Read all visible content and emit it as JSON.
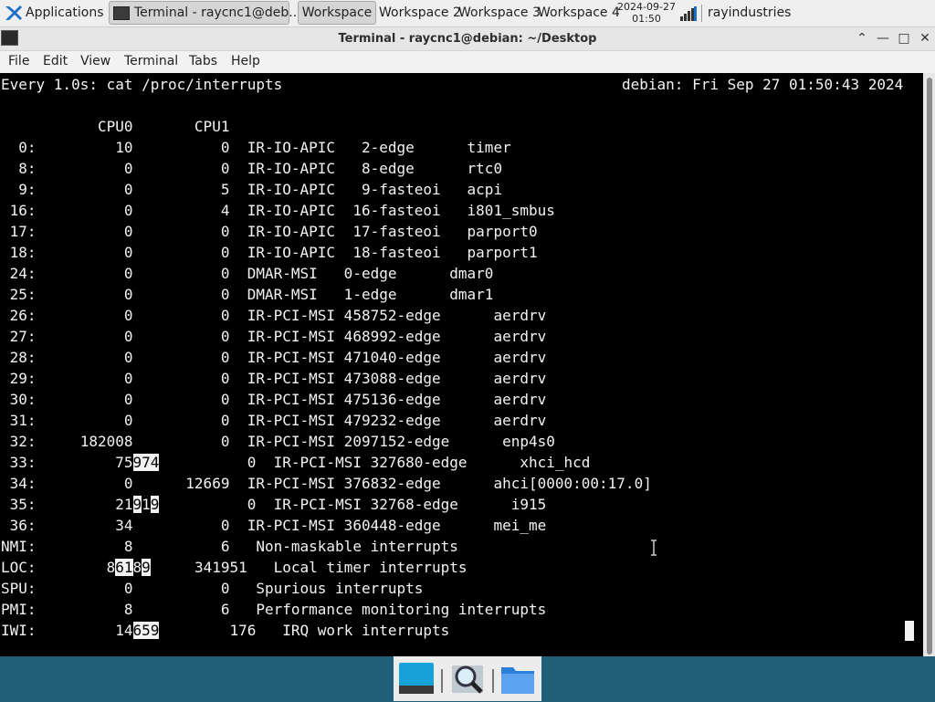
{
  "panel": {
    "applications_label": "Applications :",
    "task_label": "Terminal - raycnc1@deb...",
    "workspaces": [
      "Workspace 1",
      "Workspace 2",
      "Workspace 3",
      "Workspace 4"
    ],
    "clock_date": "2024-09-27",
    "clock_time": "01:50",
    "user_label": "rayindustries"
  },
  "window": {
    "title": "Terminal - raycnc1@debian: ~/Desktop",
    "controls": {
      "up": "⌃",
      "minimize": "—",
      "maximize": "□",
      "close": "✕"
    }
  },
  "menubar": [
    "File",
    "Edit",
    "View",
    "Terminal",
    "Tabs",
    "Help"
  ],
  "terminal": {
    "header_left": "Every 1.0s: cat /proc/interrupts",
    "header_right": "debian: Fri Sep 27 01:50:43 2024",
    "column_header": "           CPU0       CPU1",
    "rows": [
      {
        "pre": "  0:         10          0  IR-IO-APIC   2-edge      timer"
      },
      {
        "pre": "  8:          0          0  IR-IO-APIC   8-edge      rtc0"
      },
      {
        "pre": "  9:          0          5  IR-IO-APIC   9-fasteoi   acpi"
      },
      {
        "pre": " 16:          0          4  IR-IO-APIC  16-fasteoi   i801_smbus"
      },
      {
        "pre": " 17:          0          0  IR-IO-APIC  17-fasteoi   parport0"
      },
      {
        "pre": " 18:          0          0  IR-IO-APIC  18-fasteoi   parport1"
      },
      {
        "pre": " 24:          0          0  DMAR-MSI   0-edge      dmar0"
      },
      {
        "pre": " 25:          0          0  DMAR-MSI   1-edge      dmar1"
      },
      {
        "pre": " 26:          0          0  IR-PCI-MSI 458752-edge      aerdrv"
      },
      {
        "pre": " 27:          0          0  IR-PCI-MSI 468992-edge      aerdrv"
      },
      {
        "pre": " 28:          0          0  IR-PCI-MSI 471040-edge      aerdrv"
      },
      {
        "pre": " 29:          0          0  IR-PCI-MSI 473088-edge      aerdrv"
      },
      {
        "pre": " 30:          0          0  IR-PCI-MSI 475136-edge      aerdrv"
      },
      {
        "pre": " 31:          0          0  IR-PCI-MSI 479232-edge      aerdrv"
      },
      {
        "pre": " 32:     182008          0  IR-PCI-MSI 2097152-edge      enp4s0"
      },
      {
        "pre": " 33:         75",
        "hl": "974",
        "post": "          0  IR-PCI-MSI 327680-edge      xhci_hcd"
      },
      {
        "pre": " 34:          0      12669  IR-PCI-MSI 376832-edge      ahci[0000:00:17.0]"
      },
      {
        "pre": " 35:         21",
        "hl": "9",
        "mid": "1",
        "hl2": "9",
        "post": "          0  IR-PCI-MSI 32768-edge      i915"
      },
      {
        "pre": " 36:         34          0  IR-PCI-MSI 360448-edge      mei_me"
      },
      {
        "pre": "NMI:          8          6   Non-maskable interrupts"
      },
      {
        "pre": "LOC:        8",
        "hl": "61",
        "mid": "8",
        "hl2": "9",
        "post": "     341951   Local timer interrupts"
      },
      {
        "pre": "SPU:          0          0   Spurious interrupts"
      },
      {
        "pre": "PMI:          8          6   Performance monitoring interrupts"
      },
      {
        "pre": "IWI:         14",
        "hl": "659",
        "post": "        176   IRQ work interrupts"
      }
    ]
  },
  "icons": {
    "apps": "xfce-mouse-icon",
    "task": "terminal-icon",
    "net": "network-signal-icon",
    "dock": [
      "desktop-icon",
      "search-icon",
      "folder-icon"
    ]
  },
  "colors": {
    "desktop": "#1f5f77",
    "panel": "#efefef",
    "terminal_bg": "#000000",
    "terminal_fg": "#f2f2f2"
  }
}
